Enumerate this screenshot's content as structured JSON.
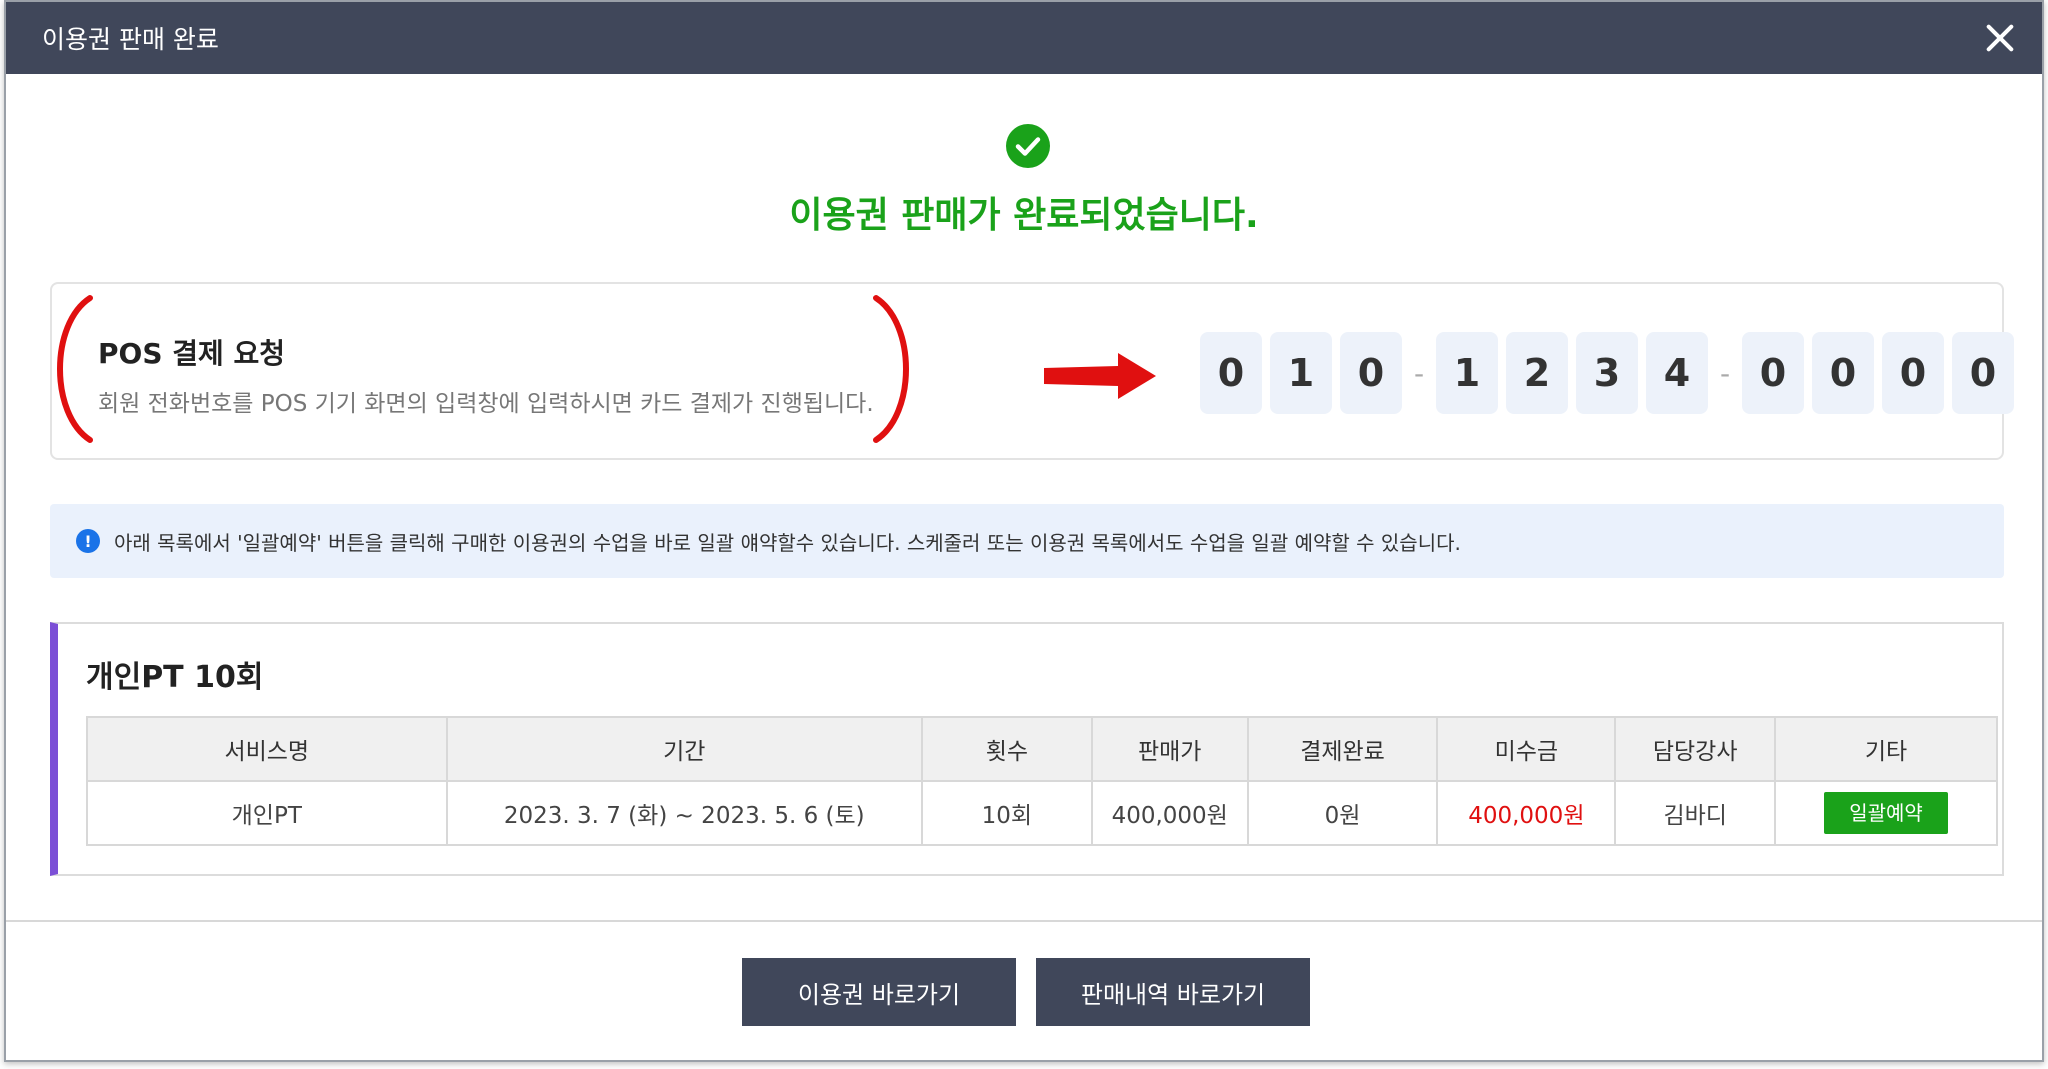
{
  "dialog": {
    "title": "이용권 판매 완료"
  },
  "success": {
    "message": "이용권 판매가 완료되었습니다."
  },
  "pos": {
    "title": "POS 결제 요청",
    "description": "회원 전화번호를 POS 기기 화면의 입력창에 입력하시면 카드 결제가 진행됩니다.",
    "digits": [
      "0",
      "1",
      "0",
      "1",
      "2",
      "3",
      "4",
      "0",
      "0",
      "0",
      "0"
    ],
    "separator": "-"
  },
  "notice": {
    "icon": "!",
    "text": "아래 목록에서 '일괄예약' 버튼을 클릭해 구매한 이용권의 수업을 바로 일괄 얘약할수 있습니다. 스케줄러 또는 이용권 목록에서도 수업을 일괄 예약할 수 있습니다."
  },
  "product": {
    "title": "개인PT 10회",
    "headers": [
      "서비스명",
      "기간",
      "횟수",
      "판매가",
      "결제완료",
      "미수금",
      "담당강사",
      "기타"
    ],
    "row": {
      "service": "개인PT",
      "period": "2023. 3. 7 (화) ~ 2023. 5. 6 (토)",
      "count": "10회",
      "price": "400,000원",
      "paid": "0원",
      "unpaid": "400,000원",
      "instructor": "김바디",
      "action": "일괄예약"
    }
  },
  "footer": {
    "ticket_button": "이용권 바로가기",
    "sales_button": "판매내역 바로가기"
  },
  "colors": {
    "header_bg": "#40475a",
    "success_green": "#1aa21a",
    "alert_red": "#e01010",
    "accent_purple": "#7b4fd6",
    "notice_bg": "#eaf1fc"
  }
}
